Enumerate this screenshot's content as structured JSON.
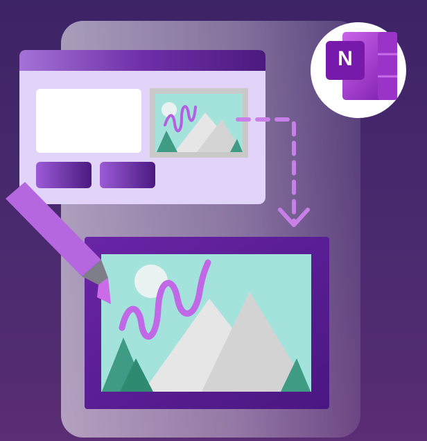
{
  "logo": {
    "letter": "N",
    "icon": "onenote-logo-icon"
  },
  "colors": {
    "background_top": "#3d2466",
    "background_bottom": "#5a2d74",
    "panel": "#d4c6e8",
    "window_body": "#e2d3f8",
    "window_bar": "#7b3fb5",
    "accent_purple": "#7719aa",
    "sky": "#a4e3dc",
    "mountain": "#e6e6e6",
    "tree": "#3f9b84",
    "scribble": "#c068e6",
    "marker": "#b567e0",
    "arrow": "#c880e8"
  },
  "illustration": {
    "icons": [
      "browser-window-icon",
      "thumbnail-image-icon",
      "dashed-arrow-icon",
      "marker-pen-icon",
      "large-picture-frame-icon",
      "sun-icon",
      "mountain-icon",
      "tree-icon",
      "scribble-icon"
    ]
  }
}
